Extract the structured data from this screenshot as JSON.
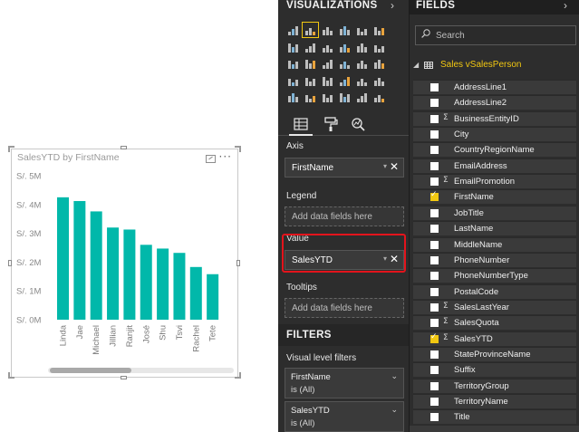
{
  "visual": {
    "title": "SalesYTD by FirstName",
    "more": "···"
  },
  "chart_data": {
    "type": "bar",
    "title": "SalesYTD by FirstName",
    "categories": [
      "Linda",
      "Jae",
      "Michael",
      "Jillian",
      "Ranjit",
      "José",
      "Shu",
      "Tsvi",
      "Rachel",
      "Tete"
    ],
    "values": [
      4.25,
      4.12,
      3.76,
      3.2,
      3.13,
      2.6,
      2.47,
      2.32,
      1.83,
      1.58
    ],
    "value_units": "millions",
    "y_tick_labels": [
      "S/. 0M",
      "S/. 1M",
      "S/. 2M",
      "S/. 3M",
      "S/. 4M",
      "S/. 5M"
    ],
    "ylim": [
      0,
      5
    ],
    "grid": false,
    "legend": "none",
    "bar_color": "#01b8aa"
  },
  "visualizations": {
    "header": "VISUALIZATIONS",
    "chevron": "›",
    "icons": [
      "stacked-bar",
      "stacked-column",
      "clustered-bar",
      "clustered-column",
      "100-bar",
      "100-column",
      "line",
      "area",
      "stacked-area",
      "line-column",
      "line-clustered",
      "ribbon",
      "waterfall",
      "scatter",
      "pie",
      "donut",
      "treemap",
      "map",
      "filled-map",
      "funnel",
      "gauge",
      "multirow-card",
      "card",
      "kpi",
      "slicer",
      "table",
      "matrix",
      "r-visual",
      "globe",
      "more"
    ],
    "axis_label": "Axis",
    "axis_value": "FirstName",
    "legend_label": "Legend",
    "legend_placeholder": "Add data fields here",
    "value_label": "Value",
    "value_value": "SalesYTD",
    "tooltips_label": "Tooltips",
    "tooltips_placeholder": "Add data fields here",
    "dropdown_glyph": "▾",
    "remove_glyph": "✕"
  },
  "filters": {
    "header": "FILTERS",
    "visual_level_label": "Visual level filters",
    "cards": [
      {
        "name": "FirstName",
        "value": "is (All)",
        "chevron": "⌄"
      },
      {
        "name": "SalesYTD",
        "value": "is (All)",
        "chevron": "⌄"
      }
    ]
  },
  "fields": {
    "header": "FIELDS",
    "chevron": "›",
    "search_placeholder": "Search",
    "expand_glyph": "◢",
    "table_name": "Sales vSalesPerson",
    "items": [
      {
        "name": "AddressLine1",
        "checked": false,
        "sigma": false
      },
      {
        "name": "AddressLine2",
        "checked": false,
        "sigma": false
      },
      {
        "name": "BusinessEntityID",
        "checked": false,
        "sigma": true
      },
      {
        "name": "City",
        "checked": false,
        "sigma": false
      },
      {
        "name": "CountryRegionName",
        "checked": false,
        "sigma": false
      },
      {
        "name": "EmailAddress",
        "checked": false,
        "sigma": false
      },
      {
        "name": "EmailPromotion",
        "checked": false,
        "sigma": true
      },
      {
        "name": "FirstName",
        "checked": true,
        "sigma": false
      },
      {
        "name": "JobTitle",
        "checked": false,
        "sigma": false
      },
      {
        "name": "LastName",
        "checked": false,
        "sigma": false
      },
      {
        "name": "MiddleName",
        "checked": false,
        "sigma": false
      },
      {
        "name": "PhoneNumber",
        "checked": false,
        "sigma": false
      },
      {
        "name": "PhoneNumberType",
        "checked": false,
        "sigma": false
      },
      {
        "name": "PostalCode",
        "checked": false,
        "sigma": false
      },
      {
        "name": "SalesLastYear",
        "checked": false,
        "sigma": true
      },
      {
        "name": "SalesQuota",
        "checked": false,
        "sigma": true
      },
      {
        "name": "SalesYTD",
        "checked": true,
        "sigma": true
      },
      {
        "name": "StateProvinceName",
        "checked": false,
        "sigma": false
      },
      {
        "name": "Suffix",
        "checked": false,
        "sigma": false
      },
      {
        "name": "TerritoryGroup",
        "checked": false,
        "sigma": false
      },
      {
        "name": "TerritoryName",
        "checked": false,
        "sigma": false
      },
      {
        "name": "Title",
        "checked": false,
        "sigma": false
      }
    ],
    "sigma_glyph": "Σ"
  },
  "colors": {
    "accent": "#f2c811",
    "highlight": "#e3141c",
    "pane_bg": "#2d2d2d"
  }
}
